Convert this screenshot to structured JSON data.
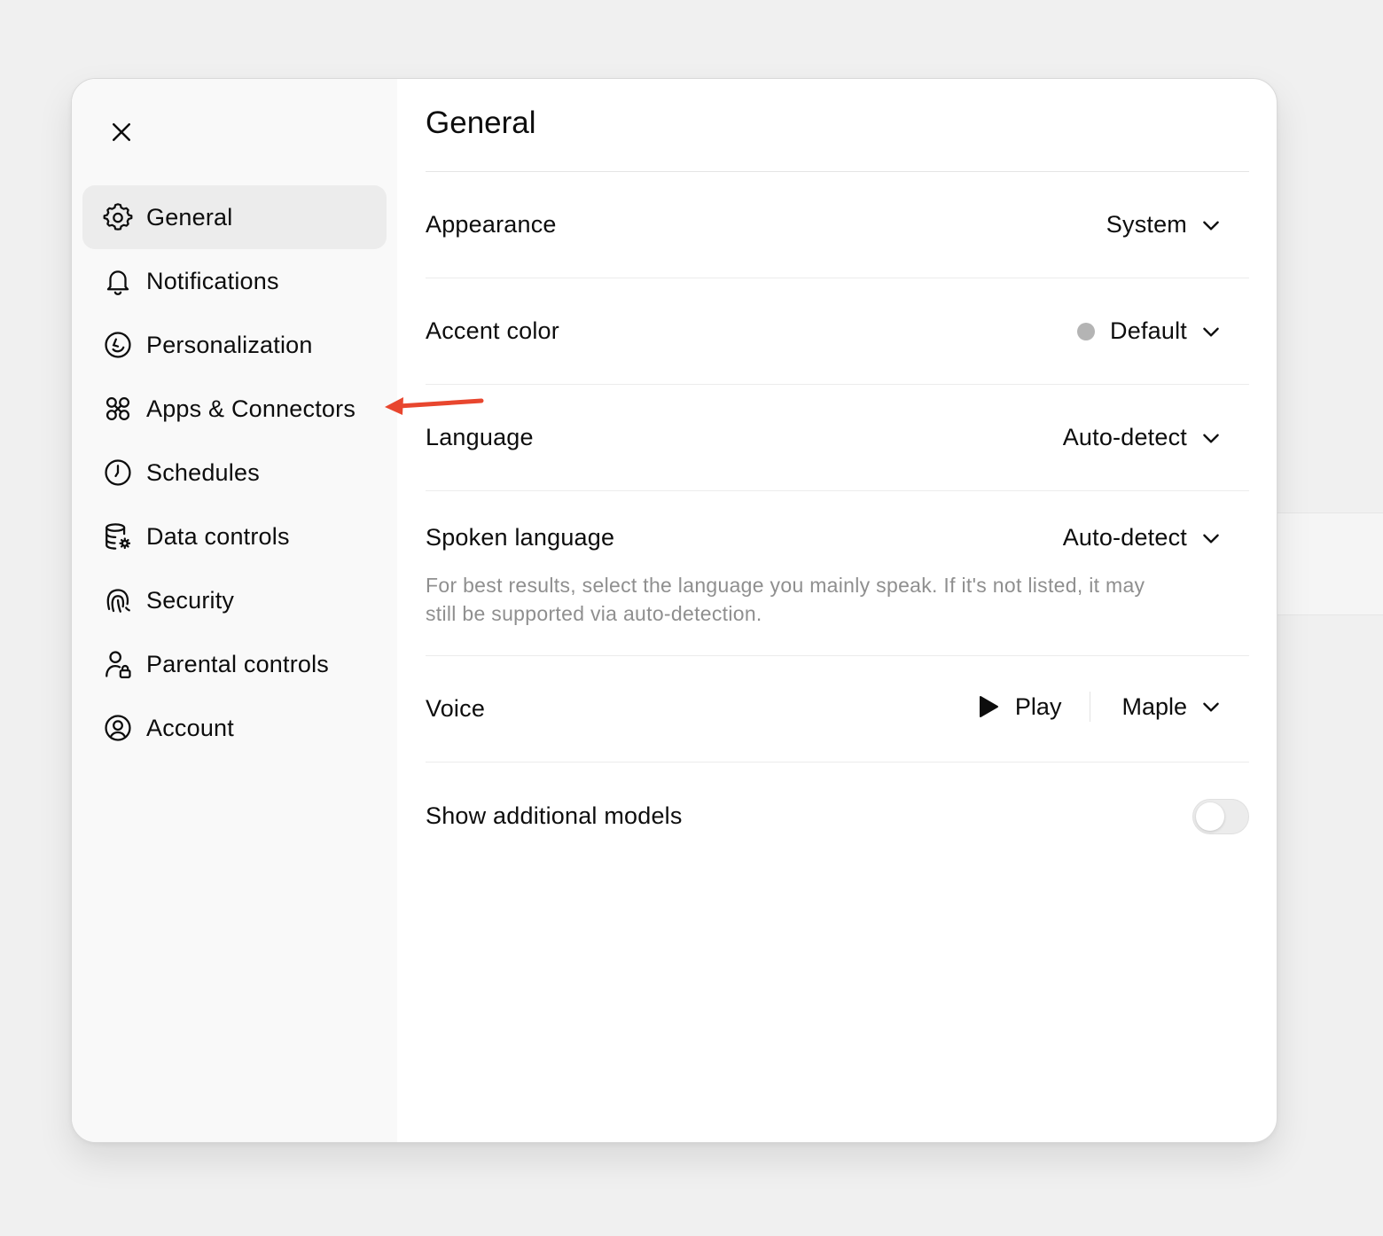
{
  "colors": {
    "page_background": "#f0f0f0",
    "sidebar_background": "#f9f9f9",
    "active_item_background": "#ececec",
    "text_primary": "#0d0d0d",
    "text_secondary": "#8f8f8f",
    "accent_dot": "#b4b4b4",
    "annotation_arrow": "#e8462e"
  },
  "close_icon": "close-icon",
  "sidebar": {
    "items": [
      {
        "label": "General",
        "icon": "gear-icon",
        "active": true
      },
      {
        "label": "Notifications",
        "icon": "bell-icon",
        "active": false
      },
      {
        "label": "Personalization",
        "icon": "personalization-icon",
        "active": false
      },
      {
        "label": "Apps & Connectors",
        "icon": "apps-icon",
        "active": false
      },
      {
        "label": "Schedules",
        "icon": "clock-icon",
        "active": false
      },
      {
        "label": "Data controls",
        "icon": "database-gear-icon",
        "active": false
      },
      {
        "label": "Security",
        "icon": "fingerprint-icon",
        "active": false
      },
      {
        "label": "Parental controls",
        "icon": "person-lock-icon",
        "active": false
      },
      {
        "label": "Account",
        "icon": "user-circle-icon",
        "active": false
      }
    ]
  },
  "main": {
    "title": "General",
    "appearance": {
      "label": "Appearance",
      "value": "System"
    },
    "accent_color": {
      "label": "Accent color",
      "value": "Default"
    },
    "language": {
      "label": "Language",
      "value": "Auto-detect"
    },
    "spoken_language": {
      "label": "Spoken language",
      "value": "Auto-detect",
      "helper": "For best results, select the language you mainly speak. If it's not listed, it may still be supported via auto-detection."
    },
    "voice": {
      "label": "Voice",
      "play_label": "Play",
      "value": "Maple"
    },
    "additional_models": {
      "label": "Show additional models",
      "enabled": false
    }
  },
  "annotation": {
    "type": "arrow",
    "points_to": "Apps & Connectors"
  }
}
